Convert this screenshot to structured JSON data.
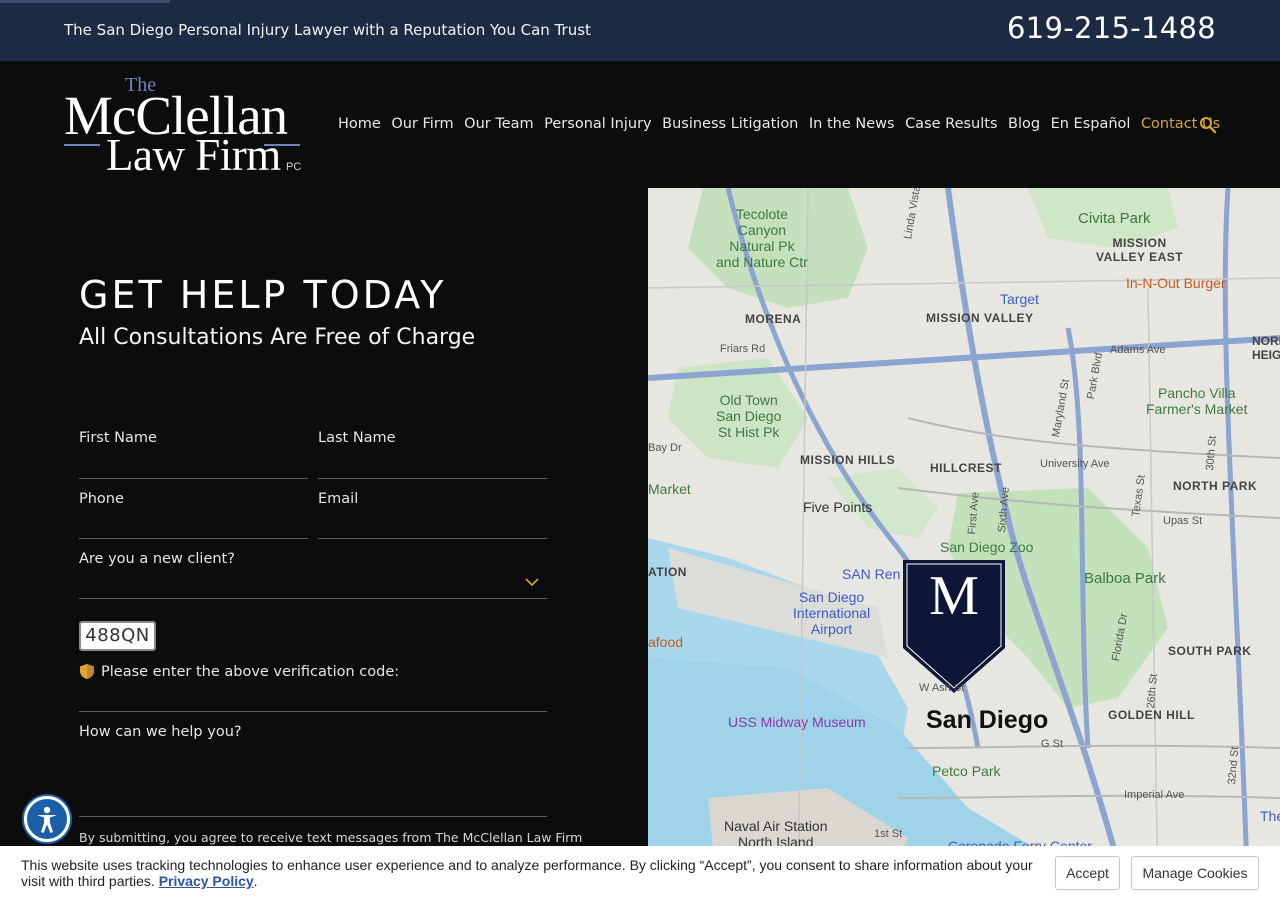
{
  "topbar": {
    "tagline": "The San Diego Personal Injury Lawyer with a Reputation You Can Trust",
    "phone": "619-215-1488"
  },
  "logo": {
    "the": "The",
    "mcclellan": "McClellan",
    "law_firm": "Law Firm",
    "pc": "PC"
  },
  "nav": {
    "items": [
      "Home",
      "Our Firm",
      "Our Team",
      "Personal Injury",
      "Business Litigation",
      "In the News",
      "Case Results",
      "Blog",
      "En Español",
      "Contact Us"
    ],
    "active_color": "#d9a53a"
  },
  "form": {
    "title": "GET HELP TODAY",
    "subtitle": "All Consultations Are Free of Charge",
    "first_name": "First Name",
    "last_name": "Last Name",
    "phone": "Phone",
    "email": "Email",
    "new_client": "Are you a new client?",
    "captcha_code": "488QN",
    "verify_label": "Please enter the above verification code:",
    "help_label": "How can we help you?",
    "terms": "By submitting, you agree to receive text messages from The McClellan Law Firm"
  },
  "map": {
    "labels": {
      "tecolote": "Tecolote\nCanyon\nNatural Pk\nand Nature Ctr",
      "civita": "Civita Park",
      "mission_valley_east": "MISSION\nVALLEY EAST",
      "in_n_out": "In-N-Out Burger",
      "target": "Target",
      "mission_valley": "MISSION VALLEY",
      "morena": "MORENA",
      "friars": "Friars Rd",
      "adams": "Adams Ave",
      "north_heights": "NORM\nHEIGH",
      "old_town": "Old Town\nSan Diego\nSt Hist Pk",
      "pancho_villa": "Pancho Villa\nFarmer's Market",
      "mission_hills": "MISSION HILLS",
      "hillcrest": "HILLCREST",
      "university": "University Ave",
      "north_park": "NORTH PARK",
      "upas": "Upas St",
      "five_points": "Five Points",
      "sd_zoo": "San Diego Zoo",
      "balboa": "Balboa Park",
      "market": "Market",
      "ation": "ATION",
      "sd_airport": "San Diego\nInternational\nAirport",
      "san_ren": "SAN Ren",
      "south_park": "SOUTH PARK",
      "afood": "afood",
      "uss_midway": "USS Midway Museum",
      "san_diego": "San Diego",
      "w_ash": "W Ash St",
      "golden_hill": "GOLDEN HILL",
      "g_st": "G St",
      "petco": "Petco Park",
      "imperial": "Imperial Ave",
      "naval": "Naval Air Station\nNorth Island",
      "coronado": "Coronado Ferry Center",
      "first_st": "1st St",
      "marker_letter": "M",
      "linda_vista": "Linda Vista Rd",
      "park_blvd": "Park Blvd",
      "maryland": "Maryland St",
      "texas": "Texas St",
      "first_ave": "First Ave",
      "sixth_ave": "Sixth Ave",
      "thirtieth": "30th St",
      "florida": "Florida Dr",
      "twentysixth": "26th St",
      "thirtysecond": "32nd St",
      "bay_dr": "Bay Dr",
      "the": "The"
    }
  },
  "cookie": {
    "text": "This website uses tracking technologies to enhance user experience and to analyze performance. By clicking “Accept”, you consent to share information about your visit with third parties.",
    "privacy": "Privacy Policy",
    "accept": "Accept",
    "manage": "Manage Cookies"
  }
}
